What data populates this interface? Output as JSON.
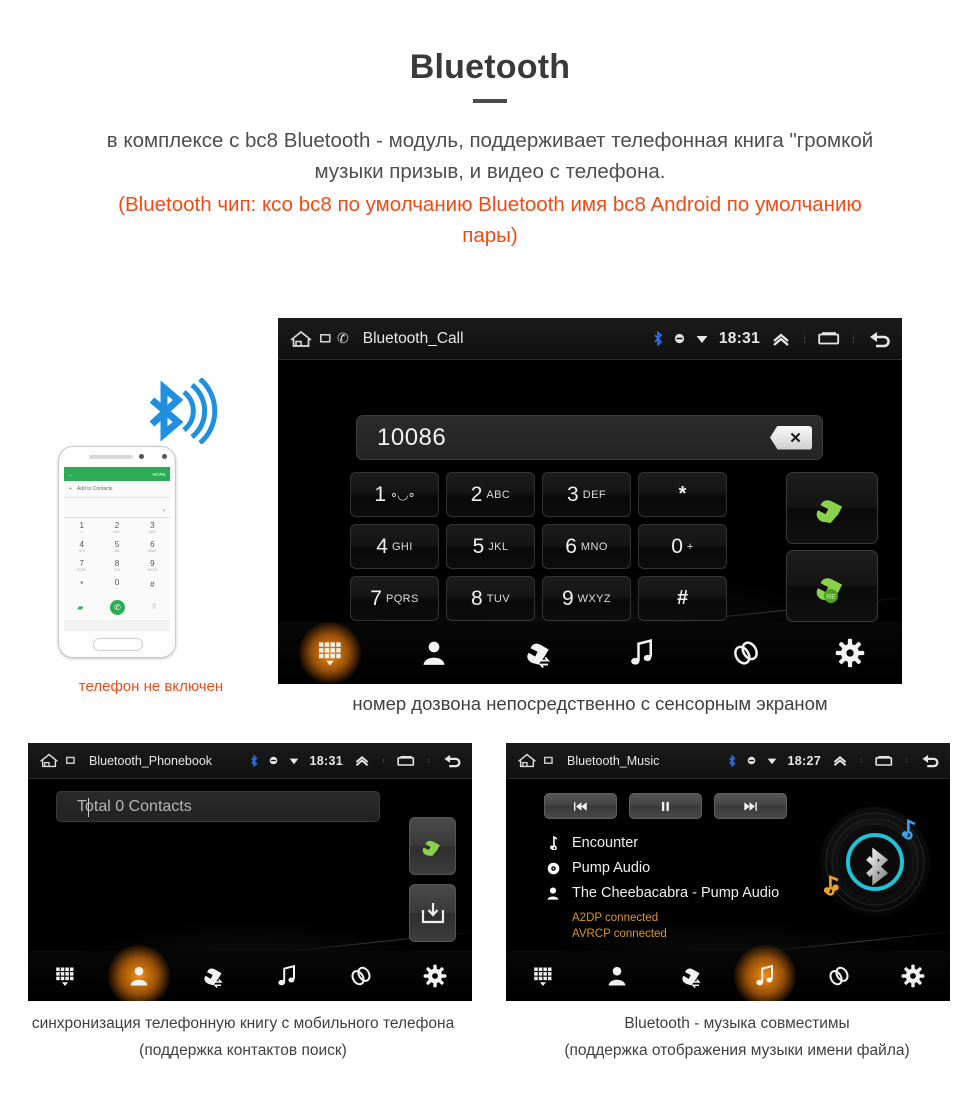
{
  "header": {
    "title": "Bluetooth",
    "intro_line1": "в комплексе с bc8 Bluetooth - модуль, поддерживает телефонная книга \"громкой",
    "intro_line2": "музыки призыв, и видео с телефона.",
    "note_line1": "(Bluetooth чип: ксо bc8 по умолчанию Bluetooth имя bc8 Android по умолчанию",
    "note_line2": "пары)"
  },
  "colors": {
    "accent_orange": "#f04b16",
    "status_orange": "#d9962c",
    "bluetooth_blue": "#1f6fd0",
    "call_green": "#8cd14a",
    "nav_highlight": "#ff9614"
  },
  "call_screen": {
    "statusbar": {
      "title": "Bluetooth_Call",
      "time": "18:31",
      "icons": [
        "home-icon",
        "screenshot-icon",
        "phone-call-icon",
        "bluetooth-icon",
        "dnd-icon",
        "wifi-icon",
        "volume-up-icon",
        "recents-icon",
        "back-icon"
      ]
    },
    "dial_value": "10086",
    "backspace_label": "✕",
    "keys": [
      [
        {
          "num": "1",
          "sub": "∘◡∘",
          "type": "one"
        },
        {
          "num": "2",
          "sub": "ABC"
        },
        {
          "num": "3",
          "sub": "DEF"
        },
        {
          "sym": "*"
        }
      ],
      [
        {
          "num": "4",
          "sub": "GHI"
        },
        {
          "num": "5",
          "sub": "JKL"
        },
        {
          "num": "6",
          "sub": "MNO"
        },
        {
          "num": "0",
          "sub": "+"
        }
      ],
      [
        {
          "num": "7",
          "sub": "PQRS"
        },
        {
          "num": "8",
          "sub": "TUV"
        },
        {
          "num": "9",
          "sub": "WXYZ"
        },
        {
          "sym": "#"
        }
      ]
    ],
    "call_button": "call-icon",
    "redial_button": "redial-icon",
    "nav": [
      {
        "name": "dialpad",
        "icon": "dialpad-icon",
        "active": true
      },
      {
        "name": "contacts",
        "icon": "contact-icon",
        "active": false
      },
      {
        "name": "call-log",
        "icon": "call-history-icon",
        "active": false
      },
      {
        "name": "music",
        "icon": "music-note-icon",
        "active": false
      },
      {
        "name": "link",
        "icon": "link-icon",
        "active": false
      },
      {
        "name": "settings",
        "icon": "gear-icon",
        "active": false
      }
    ],
    "caption": "номер дозвона непосредственно с сенсорным экраном"
  },
  "phone_illustration": {
    "screen_bar_back": "←",
    "screen_bar_more": "MORE",
    "add_to_contacts": "Add to Contacts",
    "input_hint": "✕",
    "keys": [
      {
        "n": "1",
        "s": "∞"
      },
      {
        "n": "2",
        "s": "ABC"
      },
      {
        "n": "3",
        "s": "DEF"
      },
      {
        "n": "4",
        "s": "GHI"
      },
      {
        "n": "5",
        "s": "JKL"
      },
      {
        "n": "6",
        "s": "MNO"
      },
      {
        "n": "7",
        "s": "PQRS"
      },
      {
        "n": "8",
        "s": "TUV"
      },
      {
        "n": "9",
        "s": "WXYZ"
      },
      {
        "n": "*",
        "s": ""
      },
      {
        "n": "0",
        "s": "+"
      },
      {
        "n": "#",
        "s": ""
      }
    ],
    "caption": "телефон не включен"
  },
  "phonebook_screen": {
    "statusbar": {
      "title": "Bluetooth_Phonebook",
      "time": "18:31"
    },
    "contacts_total": "Total 0 Contacts",
    "call_button": "call-icon",
    "download_button": "download-contacts-icon",
    "nav": [
      {
        "name": "dialpad",
        "icon": "dialpad-icon",
        "active": false
      },
      {
        "name": "contacts",
        "icon": "contact-icon",
        "active": true
      },
      {
        "name": "call-log",
        "icon": "call-history-icon",
        "active": false
      },
      {
        "name": "music",
        "icon": "music-note-icon",
        "active": false
      },
      {
        "name": "link",
        "icon": "link-icon",
        "active": false
      },
      {
        "name": "settings",
        "icon": "gear-icon",
        "active": false
      }
    ],
    "caption_line1": "синхронизация телефонную книгу с мобильного телефона",
    "caption_line2": "(поддержка контактов поиск)"
  },
  "music_screen": {
    "statusbar": {
      "title": "Bluetooth_Music",
      "time": "18:27"
    },
    "controls": [
      {
        "name": "previous",
        "icon": "skip-previous-icon"
      },
      {
        "name": "pause",
        "icon": "pause-icon"
      },
      {
        "name": "next",
        "icon": "skip-next-icon"
      }
    ],
    "tracks": [
      {
        "icon": "music-note-icon",
        "label": "Encounter"
      },
      {
        "icon": "album-icon",
        "label": "Pump Audio"
      },
      {
        "icon": "artist-icon",
        "label": "The Cheebacabra - Pump Audio"
      }
    ],
    "status_lines": [
      "A2DP connected",
      "AVRCP connected"
    ],
    "album_art": "bluetooth-vinyl-icon",
    "nav": [
      {
        "name": "dialpad",
        "icon": "dialpad-icon",
        "active": false
      },
      {
        "name": "contacts",
        "icon": "contact-icon",
        "active": false
      },
      {
        "name": "call-log",
        "icon": "call-history-icon",
        "active": false
      },
      {
        "name": "music",
        "icon": "music-note-icon",
        "active": true
      },
      {
        "name": "link",
        "icon": "link-icon",
        "active": false
      },
      {
        "name": "settings",
        "icon": "gear-icon",
        "active": false
      }
    ],
    "caption_line1": "Bluetooth - музыка совместимы",
    "caption_line2": "(поддержка отображения музыки имени файла)"
  }
}
